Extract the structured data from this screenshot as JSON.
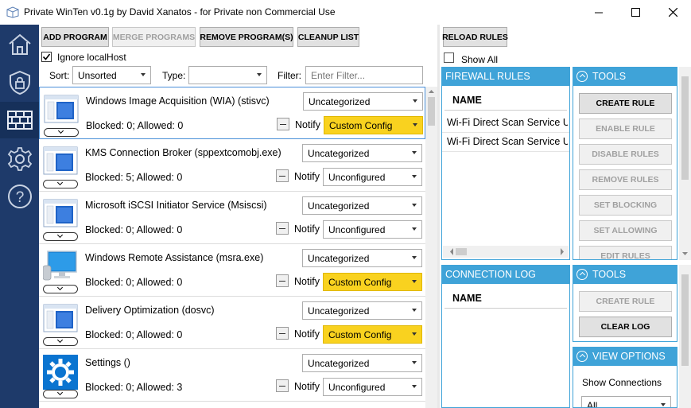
{
  "window": {
    "title": "Private WinTen v0.1g by David Xanatos - for Private non Commercial Use"
  },
  "sidebar": {
    "items": [
      {
        "name": "home-icon"
      },
      {
        "name": "shield-icon"
      },
      {
        "name": "firewall-icon"
      },
      {
        "name": "gear-icon"
      },
      {
        "name": "help-icon"
      }
    ]
  },
  "toolbar": {
    "add": "ADD PROGRAM",
    "merge": "MERGE PROGRAMS",
    "remove": "REMOVE PROGRAM(S)",
    "cleanup": "CLEANUP LIST",
    "reload": "RELOAD RULES"
  },
  "filters": {
    "ignore_localhost": "Ignore localHost",
    "sort_label": "Sort:",
    "sort_value": "Unsorted",
    "type_label": "Type:",
    "type_value": "",
    "filter_label": "Filter:",
    "filter_placeholder": "Enter Filter..."
  },
  "show_all": "Show All",
  "programs": [
    {
      "name": "Windows Image Acquisition (WIA) (stisvc)",
      "counts": "Blocked: 0; Allowed: 0",
      "category": "Uncategorized",
      "notify": "Notify",
      "config": "Custom Config",
      "icon": "window-app-icon"
    },
    {
      "name": "KMS Connection Broker (sppextcomobj.exe)",
      "counts": "Blocked: 5; Allowed: 0",
      "category": "Uncategorized",
      "notify": "Notify",
      "config": "Unconfigured",
      "icon": "window-app-icon"
    },
    {
      "name": "Microsoft iSCSI Initiator Service (Msiscsi)",
      "counts": "Blocked: 0; Allowed: 0",
      "category": "Uncategorized",
      "notify": "Notify",
      "config": "Unconfigured",
      "icon": "window-app-icon"
    },
    {
      "name": "Windows Remote Assistance (msra.exe)",
      "counts": "Blocked: 0; Allowed: 0",
      "category": "Uncategorized",
      "notify": "Notify",
      "config": "Custom Config",
      "icon": "computer-icon"
    },
    {
      "name": "Delivery Optimization (dosvc)",
      "counts": "Blocked: 0; Allowed: 0",
      "category": "Uncategorized",
      "notify": "Notify",
      "config": "Custom Config",
      "icon": "window-app-icon"
    },
    {
      "name": "Settings ()",
      "counts": "Blocked: 0; Allowed: 3",
      "category": "Uncategorized",
      "notify": "Notify",
      "config": "Unconfigured",
      "icon": "settings-gear-icon"
    }
  ],
  "firewall_rules": {
    "header": "FIREWALL RULES",
    "col_name": "NAME",
    "rows": [
      "Wi-Fi Direct Scan Service Use",
      "Wi-Fi Direct Scan Service Use"
    ]
  },
  "tools1": {
    "header": "TOOLS",
    "buttons": [
      "CREATE RULE",
      "ENABLE RULE",
      "DISABLE RULES",
      "REMOVE RULES",
      "SET BLOCKING",
      "SET ALLOWING",
      "EDIT RULES"
    ],
    "enabled": [
      true,
      false,
      false,
      false,
      false,
      false,
      false
    ]
  },
  "connection_log": {
    "header": "CONNECTION LOG",
    "col_name": "NAME"
  },
  "tools2": {
    "header": "TOOLS",
    "create": "CREATE RULE",
    "clear": "CLEAR LOG"
  },
  "view_options": {
    "header": "VIEW OPTIONS",
    "show_connections": "Show Connections",
    "value": "All"
  },
  "colors": {
    "sidebar": "#1e3a6a",
    "panel_header": "#3fa3d8",
    "custom_config": "#f9d21f"
  }
}
